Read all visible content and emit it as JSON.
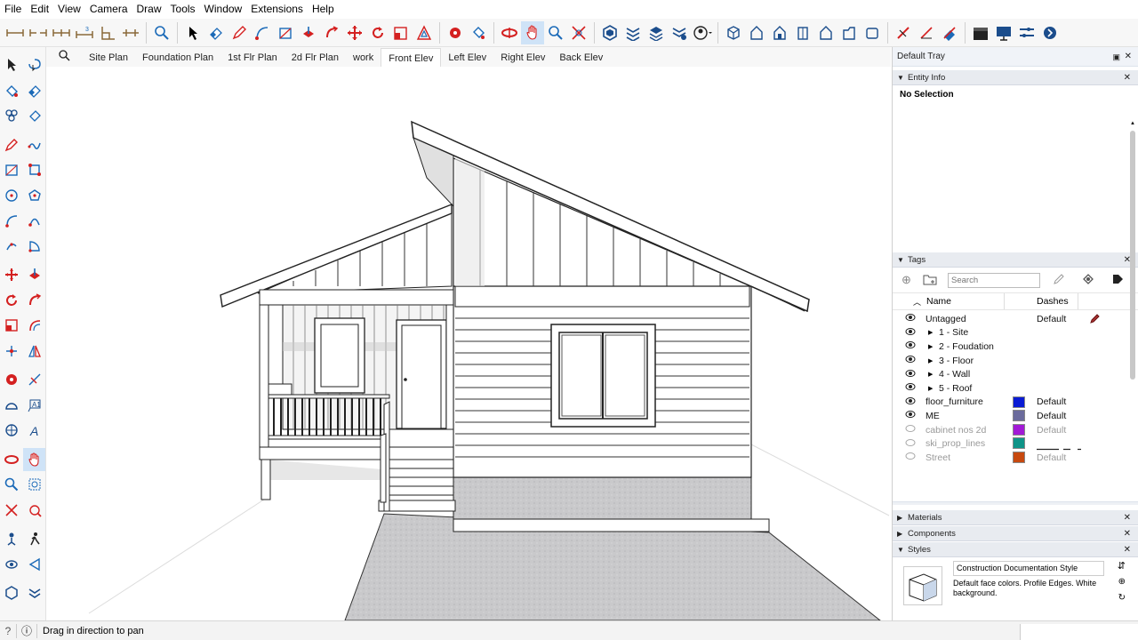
{
  "menu": [
    "File",
    "Edit",
    "View",
    "Camera",
    "Draw",
    "Tools",
    "Window",
    "Extensions",
    "Help"
  ],
  "scene_tabs": [
    {
      "label": "Site Plan",
      "active": false
    },
    {
      "label": "Foundation Plan",
      "active": false
    },
    {
      "label": "1st Flr Plan",
      "active": false
    },
    {
      "label": "2d Flr Plan",
      "active": false
    },
    {
      "label": "work",
      "active": false
    },
    {
      "label": "Front Elev",
      "active": true
    },
    {
      "label": "Left Elev",
      "active": false
    },
    {
      "label": "Right Elev",
      "active": false
    },
    {
      "label": "Back Elev",
      "active": false
    }
  ],
  "tray": {
    "title": "Default Tray",
    "entity_info": {
      "title": "Entity Info",
      "selection": "No Selection"
    },
    "tags": {
      "title": "Tags",
      "search_placeholder": "Search",
      "col_name": "Name",
      "col_dashes": "Dashes",
      "rows": [
        {
          "name": "Untagged",
          "dashes": "Default",
          "visible": true,
          "indent": false,
          "folder": false,
          "color": "",
          "pencil": true
        },
        {
          "name": "1 - Site",
          "dashes": "",
          "visible": true,
          "indent": true,
          "folder": true,
          "color": ""
        },
        {
          "name": "2 - Foudation",
          "dashes": "",
          "visible": true,
          "indent": true,
          "folder": true,
          "color": ""
        },
        {
          "name": "3 - Floor",
          "dashes": "",
          "visible": true,
          "indent": true,
          "folder": true,
          "color": ""
        },
        {
          "name": "4 - Wall",
          "dashes": "",
          "visible": true,
          "indent": true,
          "folder": true,
          "color": ""
        },
        {
          "name": "5 - Roof",
          "dashes": "",
          "visible": true,
          "indent": true,
          "folder": true,
          "color": ""
        },
        {
          "name": "floor_furniture",
          "dashes": "Default",
          "visible": true,
          "indent": false,
          "folder": false,
          "color": "#0a1bd4"
        },
        {
          "name": "ME",
          "dashes": "Default",
          "visible": true,
          "indent": false,
          "folder": false,
          "color": "#6b6b9c"
        },
        {
          "name": "cabinet nos 2d",
          "dashes": "Default",
          "visible": false,
          "indent": false,
          "folder": false,
          "color": "#a21ad6"
        },
        {
          "name": "ski_prop_lines",
          "dashes": "",
          "visible": false,
          "indent": false,
          "folder": false,
          "color": "#0f9488",
          "dashpattern": true
        },
        {
          "name": "Street",
          "dashes": "Default",
          "visible": false,
          "indent": false,
          "folder": false,
          "color": "#c7490f"
        }
      ]
    },
    "materials": {
      "title": "Materials"
    },
    "components": {
      "title": "Components"
    },
    "styles": {
      "title": "Styles",
      "style_name": "Construction Documentation Style",
      "description": "Default face colors. Profile Edges. White background."
    }
  },
  "status": {
    "message": "Drag in direction to pan"
  },
  "active_tool": "pan-tool-icon",
  "colors": {
    "accent": "#cfe3f7",
    "toolbar_bg": "#f7f7f7",
    "red_tool": "#d42020",
    "blue_tool": "#1b6ab8"
  }
}
